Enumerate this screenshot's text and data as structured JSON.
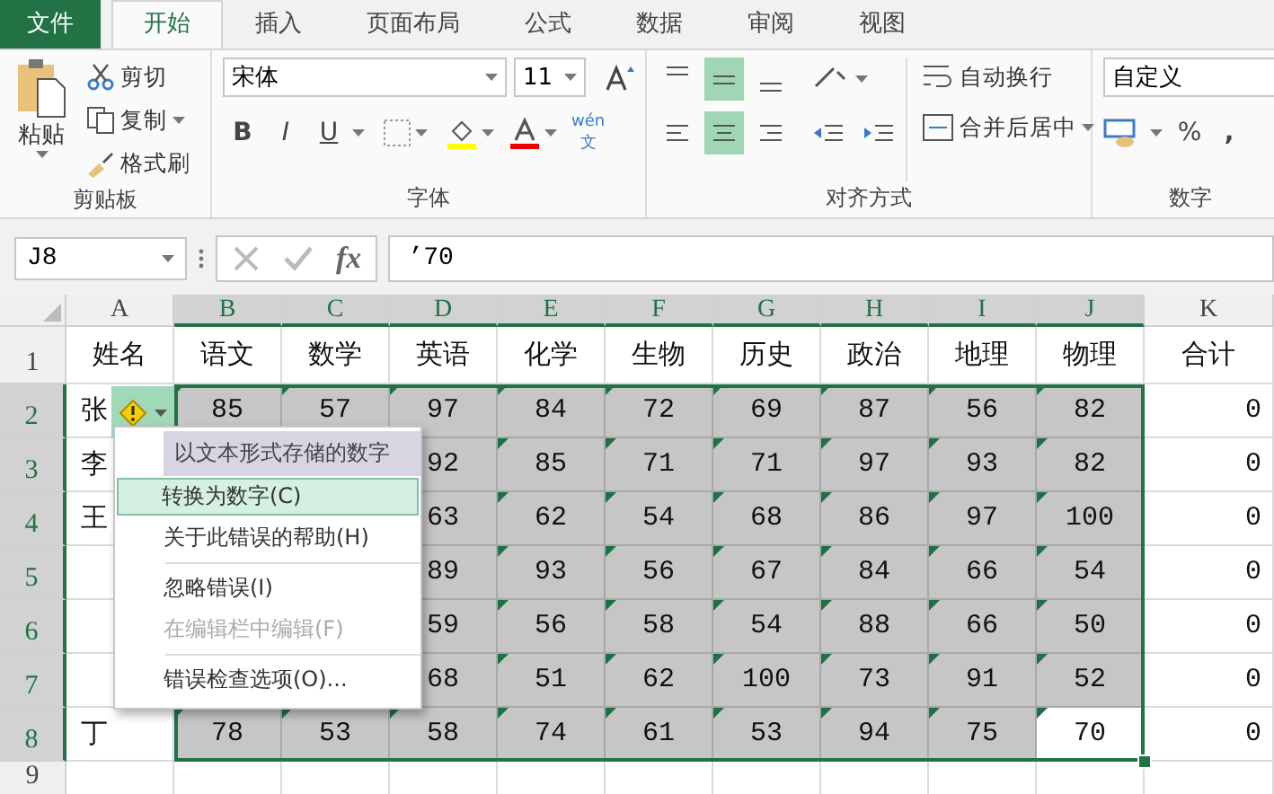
{
  "tabs": [
    {
      "label": "文件",
      "kind": "file",
      "selected": false
    },
    {
      "label": "开始",
      "kind": "tab",
      "selected": true
    },
    {
      "label": "插入",
      "kind": "tab",
      "selected": false
    },
    {
      "label": "页面布局",
      "kind": "tab",
      "selected": false
    },
    {
      "label": "公式",
      "kind": "tab",
      "selected": false
    },
    {
      "label": "数据",
      "kind": "tab",
      "selected": false
    },
    {
      "label": "审阅",
      "kind": "tab",
      "selected": false
    },
    {
      "label": "视图",
      "kind": "tab",
      "selected": false
    }
  ],
  "ribbon": {
    "clipboard": {
      "paste": "粘贴",
      "cut": "剪切",
      "copy": "复制",
      "painter": "格式刷",
      "label": "剪贴板"
    },
    "font": {
      "name": "宋体",
      "size": "11",
      "bold": "B",
      "italic": "I",
      "underline": "U",
      "phonetic_top": "wén",
      "phonetic_bottom": "文",
      "label": "字体"
    },
    "alignment": {
      "vertical": [
        {
          "selected": false
        },
        {
          "selected": true
        },
        {
          "selected": false
        }
      ],
      "horizontal": [
        {
          "selected": false
        },
        {
          "selected": true
        },
        {
          "selected": false
        }
      ],
      "wrap": "自动换行",
      "merge": "合并后居中",
      "label": "对齐方式"
    },
    "number": {
      "format": "自定义",
      "percent": "%",
      "comma": ",",
      "label": "数字"
    }
  },
  "formula_bar": {
    "name_box": "J8",
    "fx": "fx",
    "formula": "’70"
  },
  "columns": [
    {
      "label": "A",
      "selected": false
    },
    {
      "label": "B",
      "selected": true
    },
    {
      "label": "C",
      "selected": true
    },
    {
      "label": "D",
      "selected": true
    },
    {
      "label": "E",
      "selected": true
    },
    {
      "label": "F",
      "selected": true
    },
    {
      "label": "G",
      "selected": true
    },
    {
      "label": "H",
      "selected": true
    },
    {
      "label": "I",
      "selected": true
    },
    {
      "label": "J",
      "selected": true
    },
    {
      "label": "K",
      "selected": false
    }
  ],
  "rows": [
    {
      "number": "1",
      "selected": false,
      "cells": [
        "姓名",
        "语文",
        "数学",
        "英语",
        "化学",
        "生物",
        "历史",
        "政治",
        "地理",
        "物理",
        "合计"
      ]
    },
    {
      "number": "2",
      "selected": true,
      "cells": [
        "张",
        "85",
        "57",
        "97",
        "84",
        "72",
        "69",
        "87",
        "56",
        "82",
        "0"
      ]
    },
    {
      "number": "3",
      "selected": true,
      "cells": [
        "李",
        null,
        null,
        "92",
        "85",
        "71",
        "71",
        "97",
        "93",
        "82",
        "0"
      ]
    },
    {
      "number": "4",
      "selected": true,
      "cells": [
        "王",
        null,
        null,
        "63",
        "62",
        "54",
        "68",
        "86",
        "97",
        "100",
        "0"
      ]
    },
    {
      "number": "5",
      "selected": true,
      "cells": [
        null,
        null,
        null,
        "89",
        "93",
        "56",
        "67",
        "84",
        "66",
        "54",
        "0"
      ]
    },
    {
      "number": "6",
      "selected": true,
      "cells": [
        null,
        null,
        null,
        "59",
        "56",
        "58",
        "54",
        "88",
        "66",
        "50",
        "0"
      ]
    },
    {
      "number": "7",
      "selected": true,
      "cells": [
        null,
        null,
        null,
        "68",
        "51",
        "62",
        "100",
        "73",
        "91",
        "52",
        "0"
      ]
    },
    {
      "number": "8",
      "selected": true,
      "cells": [
        "丁",
        "78",
        "53",
        "58",
        "74",
        "61",
        "53",
        "94",
        "75",
        "70",
        "0"
      ]
    },
    {
      "number": "9",
      "selected": false,
      "cells": [
        null,
        null,
        null,
        null,
        null,
        null,
        null,
        null,
        null,
        null,
        null
      ]
    }
  ],
  "error_menu": {
    "title": "以文本形式存储的数字",
    "items": [
      {
        "kind": "item",
        "label": "转换为数字(C)",
        "selected": true,
        "disabled": false
      },
      {
        "kind": "item",
        "label": "关于此错误的帮助(H)",
        "selected": false,
        "disabled": false
      },
      {
        "kind": "separator"
      },
      {
        "kind": "item",
        "label": "忽略错误(I)",
        "selected": false,
        "disabled": false
      },
      {
        "kind": "item",
        "label": "在编辑栏中编辑(F)",
        "selected": false,
        "disabled": true
      },
      {
        "kind": "separator"
      },
      {
        "kind": "item",
        "label": "错误检查选项(O)...",
        "selected": false,
        "disabled": false
      }
    ]
  }
}
